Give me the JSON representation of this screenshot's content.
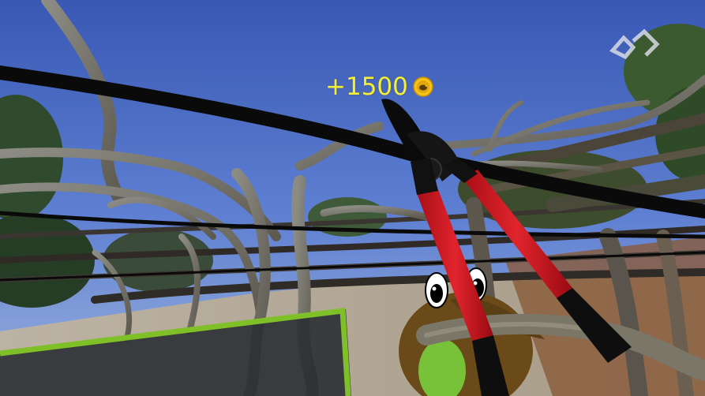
{
  "hud": {
    "score_popup": "+1500",
    "coin_icon": "kiwi-coin-icon",
    "watermark_icon": "game-logo-icon"
  },
  "colors": {
    "score_text": "#f2ee3c",
    "coin": "#f4c21a",
    "frame": "#7fc028",
    "tool_handle": "#d4141e",
    "sky": "#4b6fc7"
  }
}
